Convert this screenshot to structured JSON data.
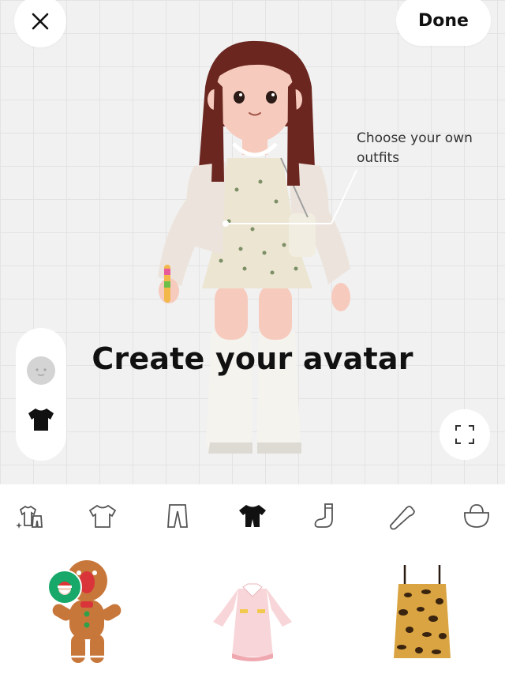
{
  "top_bar": {
    "close_icon": "close-icon",
    "done_label": "Done"
  },
  "stage": {
    "callout": "Choose your own outfits",
    "headline": "Create your avatar"
  },
  "side_panel": {
    "items": [
      {
        "name": "face",
        "icon": "face-icon"
      },
      {
        "name": "outfit",
        "icon": "tshirt-icon"
      }
    ]
  },
  "categories": [
    {
      "name": "sets",
      "icon": "sparkle-outfit-icon",
      "selected": false
    },
    {
      "name": "tops",
      "icon": "tshirt-icon",
      "selected": false
    },
    {
      "name": "bottoms",
      "icon": "pants-icon",
      "selected": false
    },
    {
      "name": "dresses",
      "icon": "dress-icon",
      "selected": true
    },
    {
      "name": "socks",
      "icon": "sock-icon",
      "selected": false
    },
    {
      "name": "shoes",
      "icon": "shoe-icon",
      "selected": false
    },
    {
      "name": "bags",
      "icon": "bag-icon",
      "selected": false
    }
  ],
  "items": [
    {
      "name": "gingerbread costume",
      "badge": "santa-badge-icon"
    },
    {
      "name": "pink collar dress"
    },
    {
      "name": "leopard print slip dress"
    }
  ],
  "colors": {
    "stage_bg": "#f1f1f1",
    "badge_green": "#17a86a",
    "selected_icon": "#111111",
    "unselected_icon": "#555555"
  }
}
